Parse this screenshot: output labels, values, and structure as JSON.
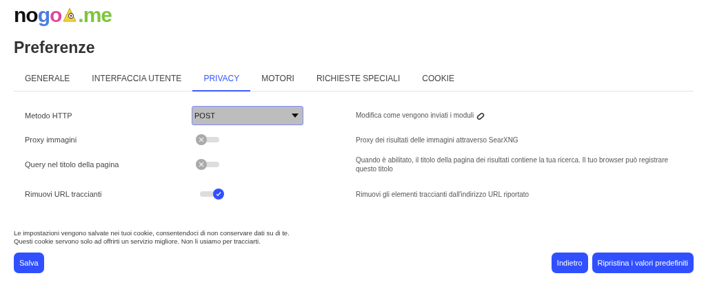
{
  "logo": {
    "name": "nogo",
    "suffix": ".me"
  },
  "title": "Preferenze",
  "tabs": [
    {
      "label": "GENERALE",
      "selected": false
    },
    {
      "label": "INTERFACCIA UTENTE",
      "selected": false
    },
    {
      "label": "PRIVACY",
      "selected": true
    },
    {
      "label": "MOTORI",
      "selected": false
    },
    {
      "label": "RICHIESTE SPECIALI",
      "selected": false
    },
    {
      "label": "COOKIE",
      "selected": false
    }
  ],
  "settings": [
    {
      "kind": "select",
      "label": "Metodo HTTP",
      "value": "POST",
      "description": "Modifica come vengono inviati i moduli",
      "info_icon": true
    },
    {
      "kind": "toggle",
      "label": "Proxy immagini",
      "on": false,
      "description": "Proxy dei risultati delle immagini attraverso SearXNG"
    },
    {
      "kind": "toggle",
      "label": "Query nel titolo della pagina",
      "on": false,
      "description": "Quando è abilitato, il titolo della pagina dei risultati contiene la tua ricerca. Il tuo browser può registrare questo titolo"
    },
    {
      "kind": "toggle",
      "label": "Rimuovi URL traccianti",
      "on": true,
      "description": "Rimuovi gli elementi traccianti dall'indirizzo URL riportato"
    }
  ],
  "notice": [
    "Le impostazioni vengono salvate nei tuoi cookie, consentendoci di non conservare dati su di te.",
    "Questi cookie servono solo ad offrirti un servizio migliore. Non li usiamo per tracciarti."
  ],
  "save_button": "Salva",
  "right_buttons": [
    "Indietro",
    "Ripristina i valori predefiniti"
  ]
}
